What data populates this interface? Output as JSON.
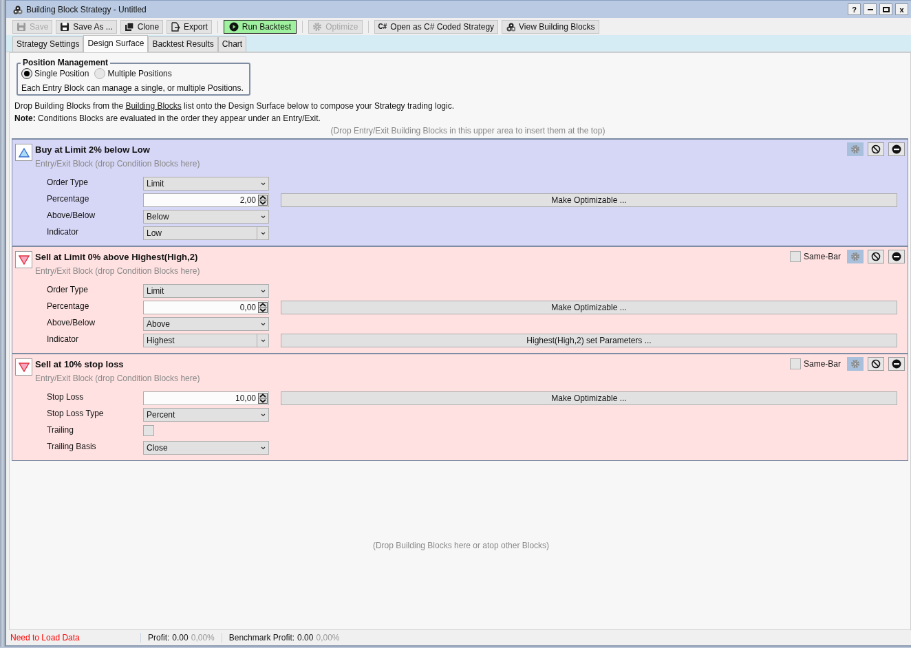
{
  "window": {
    "title": "Building Block Strategy - Untitled",
    "help": "?",
    "close": "x"
  },
  "toolbar": [
    [
      {
        "label": "Save",
        "disabled": true,
        "highlighted": false
      },
      {
        "label": "Save As ...",
        "disabled": false,
        "highlighted": false
      },
      {
        "label": "Clone",
        "disabled": false,
        "highlighted": false
      },
      {
        "label": "Export",
        "disabled": false,
        "highlighted": false
      }
    ],
    [
      {
        "label": "Run Backtest",
        "disabled": false,
        "highlighted": true
      }
    ],
    [
      {
        "label": "Optimize",
        "disabled": true,
        "highlighted": false
      }
    ],
    [
      {
        "label": "Open as C# Coded Strategy",
        "badge": "C#",
        "disabled": false,
        "highlighted": false
      },
      {
        "label": "View Building Blocks",
        "disabled": false,
        "highlighted": false
      }
    ]
  ],
  "tabs": [
    {
      "label": "Strategy Settings",
      "selected": false
    },
    {
      "label": "Design Surface",
      "selected": true
    },
    {
      "label": "Backtest Results",
      "selected": false
    },
    {
      "label": "Chart",
      "selected": false
    }
  ],
  "position_management": {
    "title": "Position Management",
    "options": [
      {
        "label": "Single Position",
        "selected": true
      },
      {
        "label": "Multiple Positions",
        "selected": false
      }
    ],
    "note": "Each Entry Block can manage a single, or multiple Positions."
  },
  "intro": {
    "before": "Drop Building Blocks from the ",
    "link": "Building Blocks",
    "after": " list onto the Design Surface below to compose your Strategy trading logic."
  },
  "note": "**Note:** Conditions Blocks are evaluated in the order they appear under an Entry/Exit.",
  "top_hint": "(Drop Entry/Exit Building Blocks in this upper area to insert them at the top)",
  "blocks": [
    {
      "kind": "entry",
      "title": "Buy at Limit 2% below Low",
      "subtitle": "Entry/Exit Block (drop Condition Blocks here)",
      "params": [
        {
          "kind": "dropdown",
          "label": "Order Type",
          "value": "Limit"
        },
        {
          "kind": "spinner",
          "label": "Percentage",
          "value": "2,00",
          "action": "Make Optimizable ..."
        },
        {
          "kind": "dropdown",
          "label": "Above/Below",
          "value": "Below"
        },
        {
          "kind": "combo",
          "label": "Indicator",
          "value": "Low"
        }
      ]
    },
    {
      "kind": "exit",
      "title": "Sell at Limit 0% above Highest(High,2)",
      "subtitle": "Entry/Exit Block (drop Condition Blocks here)",
      "same_bar": {
        "label": "Same-Bar",
        "checked": false
      },
      "params": [
        {
          "kind": "dropdown",
          "label": "Order Type",
          "value": "Limit"
        },
        {
          "kind": "spinner",
          "label": "Percentage",
          "value": "0,00",
          "action": "Make Optimizable ..."
        },
        {
          "kind": "dropdown",
          "label": "Above/Below",
          "value": "Above"
        },
        {
          "kind": "combo",
          "label": "Indicator",
          "value": "Highest",
          "action": "Highest(High,2) set Parameters ..."
        }
      ]
    },
    {
      "kind": "exit",
      "title": "Sell at 10% stop loss",
      "subtitle": "Entry/Exit Block (drop Condition Blocks here)",
      "same_bar": {
        "label": "Same-Bar",
        "checked": false
      },
      "params": [
        {
          "kind": "spinner",
          "label": "Stop Loss",
          "value": "10,00",
          "action": "Make Optimizable ..."
        },
        {
          "kind": "dropdown",
          "label": "Stop Loss Type",
          "value": "Percent"
        },
        {
          "kind": "checkbox",
          "label": "Trailing",
          "checked": false
        },
        {
          "kind": "dropdown",
          "label": "Trailing Basis",
          "value": "Close"
        }
      ]
    }
  ],
  "bottom_hint": "(Drop Building Blocks here or atop other Blocks)",
  "status_bar": {
    "message": "Need to Load Data",
    "profit_label": "Profit:",
    "profit": "0.00",
    "profit_pct": "0,00%",
    "benchmark_label": "Benchmark Profit:",
    "benchmark": "0.00",
    "benchmark_pct": "0,00%"
  }
}
